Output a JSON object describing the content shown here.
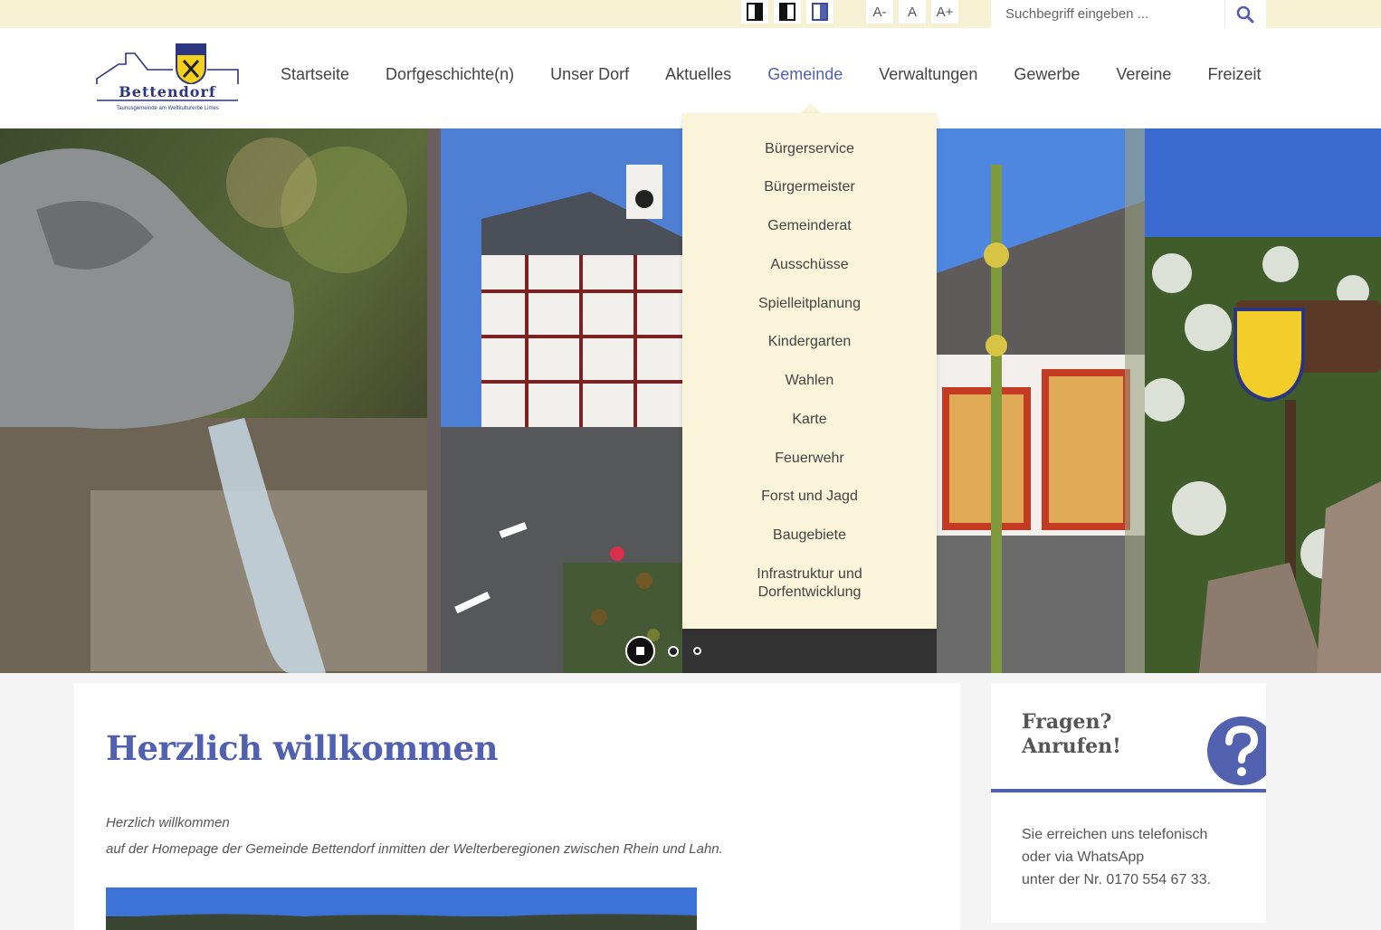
{
  "accessibility": {
    "contrast_buttons": [
      "contrast-default-icon",
      "contrast-inverted-icon",
      "contrast-blue-icon"
    ],
    "font_decrease": "A-",
    "font_normal": "A",
    "font_increase": "A+"
  },
  "search": {
    "placeholder": "Suchbegriff eingeben ...",
    "icon": "search-icon"
  },
  "logo": {
    "name": "Bettendorf",
    "tagline": "Taunusgemeinde am Weltkulturerbe Limes"
  },
  "nav": {
    "items": [
      "Startseite",
      "Dorfgeschichte(n)",
      "Unser Dorf",
      "Aktuelles",
      "Gemeinde",
      "Verwaltungen",
      "Gewerbe",
      "Vereine",
      "Freizeit"
    ],
    "active": "Gemeinde"
  },
  "dropdown": {
    "items": [
      "Bürgerservice",
      "Bürgermeister",
      "Gemeinderat",
      "Ausschüsse",
      "Spielleitplanung",
      "Kindergarten",
      "Wahlen",
      "Karte",
      "Feuerwehr",
      "Forst und Jagd",
      "Baugebiete",
      "Infrastruktur und",
      "Dorfentwicklung"
    ]
  },
  "slider": {
    "slides": 3,
    "current": 1
  },
  "main": {
    "title": "Herzlich willkommen",
    "intro_line1": "Herzlich willkommen",
    "intro_line2": "auf der  Homepage der Gemeinde Bettendorf inmitten der Welterberegionen zwischen Rhein und Lahn."
  },
  "sidebar": {
    "title_line1": "Fragen?",
    "title_line2": "Anrufen!",
    "text_line1": "Sie erreichen uns telefonisch",
    "text_line2": "oder via WhatsApp",
    "text_line3": "unter der Nr. 0170 554 67 33."
  },
  "colors": {
    "accent": "#5260b0",
    "topbar": "#f7f1d3",
    "dropdown": "#f9f4da"
  }
}
